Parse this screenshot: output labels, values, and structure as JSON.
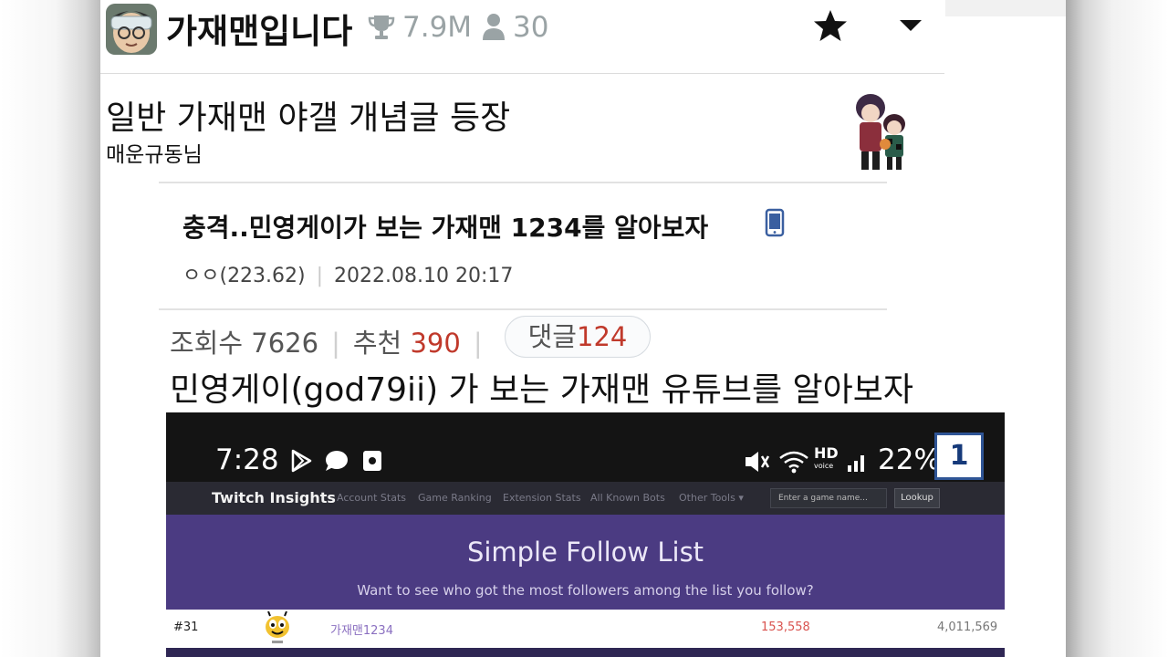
{
  "channel": {
    "name": "가재맨입니다",
    "trophy_count": "7.9M",
    "member_count": "30"
  },
  "post": {
    "title": "일반 가재맨 야갤 개념글 등장",
    "author": "매운규동님"
  },
  "gallery_post": {
    "title": "충격..민영게이가 보는 가재맨 1234를 알아보자",
    "writer": "ㅇㅇ(223.62)",
    "date": "2022.08.10 20:17",
    "views_label": "조회수",
    "views": "7626",
    "recommend_label": "추천",
    "recommend": "390",
    "comments_label": "댓글",
    "comments": "124",
    "body": "민영게이(god79ii) 가 보는 가재맨 유튜브를 알아보자"
  },
  "screenshot": {
    "time": "7:28",
    "battery": "22%",
    "hd_label": "HD",
    "voice_label": "voice",
    "badge": "1",
    "site_name": "Twitch Insights",
    "nav": [
      "Account Stats",
      "Game Ranking",
      "Extension Stats",
      "All Known Bots",
      "Other Tools ▾"
    ],
    "search_placeholder": "Enter a game name...",
    "lookup_button": "Lookup",
    "hero_title": "Simple Follow List",
    "hero_subtitle": "Want to see who got the most followers among the list you follow?",
    "row": {
      "rank": "#31",
      "name": "가재맨1234",
      "followers": "153,558",
      "views": "4,011,569"
    }
  },
  "colors": {
    "accent_red": "#c0392b",
    "hero_purple": "#4b3b82",
    "badge_blue": "#2f5596"
  }
}
